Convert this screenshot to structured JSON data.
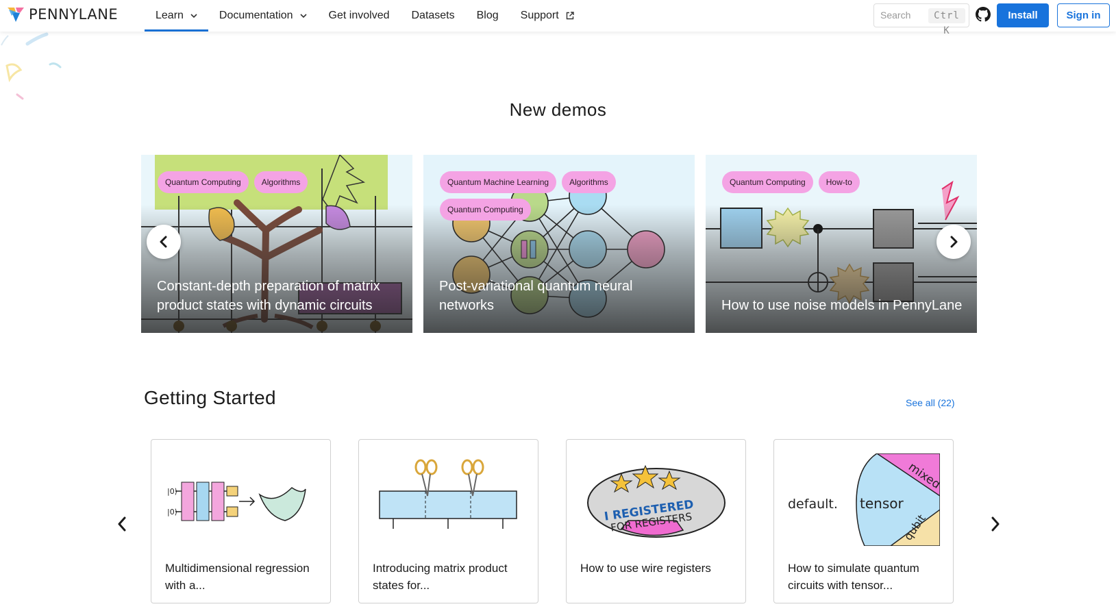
{
  "brand": {
    "name": "PENNYLANE",
    "logo_icon": "pennylane-logo-icon"
  },
  "nav": {
    "items": [
      {
        "label": "Learn",
        "has_dropdown": true,
        "active": true
      },
      {
        "label": "Documentation",
        "has_dropdown": true,
        "active": false
      },
      {
        "label": "Get involved",
        "has_dropdown": false,
        "active": false
      },
      {
        "label": "Datasets",
        "has_dropdown": false,
        "active": false
      },
      {
        "label": "Blog",
        "has_dropdown": false,
        "active": false
      },
      {
        "label": "Support",
        "has_dropdown": false,
        "external": true,
        "active": false
      }
    ],
    "search_placeholder": "Search",
    "search_shortcut": "Ctrl K",
    "github_icon": "github-icon",
    "install_label": "Install",
    "signin_label": "Sign in"
  },
  "new_demos": {
    "heading": "New demos",
    "cards": [
      {
        "tags": [
          "Quantum Computing",
          "Algorithms"
        ],
        "title": "Constant-depth preparation of matrix product states with dynamic circuits",
        "art": "tree-circuit-illustration"
      },
      {
        "tags": [
          "Quantum Machine Learning",
          "Algorithms",
          "Quantum Computing"
        ],
        "title": "Post-variational quantum neural networks",
        "art": "neural-network-illustration"
      },
      {
        "tags": [
          "Quantum Computing",
          "How-to"
        ],
        "title": "How to use noise models in PennyLane",
        "art": "noisy-circuit-illustration"
      }
    ]
  },
  "getting_started": {
    "heading": "Getting Started",
    "see_all": "See all (22)",
    "cards": [
      {
        "title": "Multidimensional regression with a...",
        "art": "regression-circuit-illustration"
      },
      {
        "title": "Introducing matrix product states for...",
        "art": "scissors-mps-illustration"
      },
      {
        "title": "How to use wire registers",
        "art": "registered-badge-illustration",
        "badge_text": [
          "I REGISTERED",
          "FOR REGISTERS"
        ]
      },
      {
        "title": "How to simulate quantum circuits with tensor...",
        "art": "tensor-wheel-illustration",
        "wheel_labels": [
          "default.",
          "tensor",
          "mixed",
          "qubit"
        ]
      }
    ]
  },
  "colors": {
    "accent": "#1873dc",
    "tag_bg": "#f4a3e4",
    "sky": "#e4f4fb"
  }
}
